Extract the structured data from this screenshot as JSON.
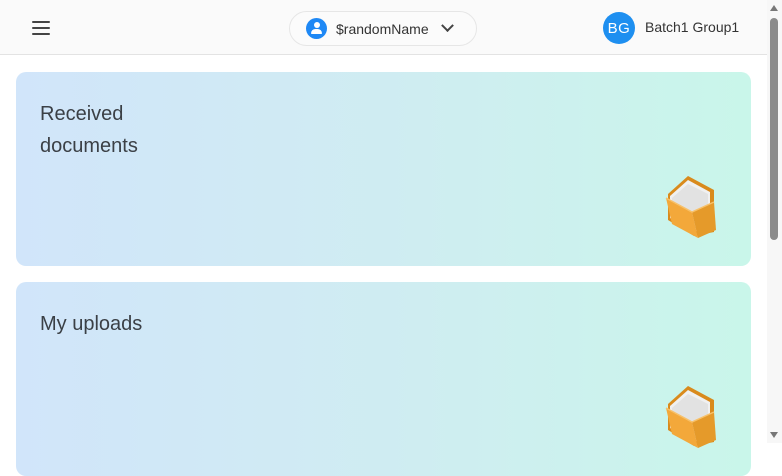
{
  "header": {
    "menu_icon": "hamburger-menu-icon",
    "account_selector": {
      "icon": "person-icon",
      "label": "$randomName",
      "chevron": "chevron-down-icon"
    },
    "user": {
      "initials": "BG",
      "name": "Batch1 Group1",
      "avatar_color": "#1e8ff0"
    }
  },
  "cards": [
    {
      "title": "Received documents",
      "icon": "folder-icon"
    },
    {
      "title": "My uploads",
      "icon": "folder-icon"
    }
  ],
  "colors": {
    "accent": "#1e88f5",
    "card_gradient_start": "#d1e5fa",
    "card_gradient_end": "#c9f6ea"
  }
}
